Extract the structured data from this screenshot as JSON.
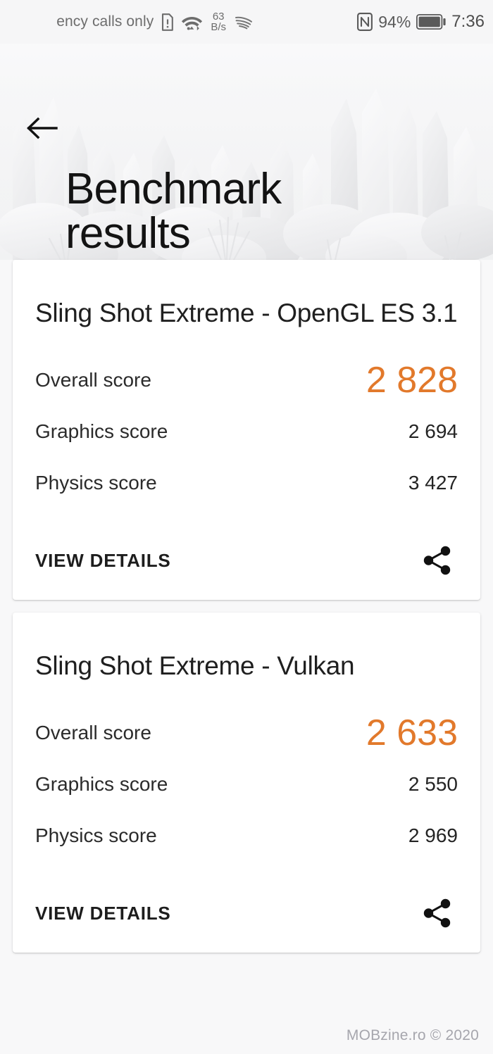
{
  "status_bar": {
    "carrier": "ency calls only",
    "sim_icon": "sim-alert-icon",
    "wifi_icon": "wifi-icon",
    "network_speed_value": "63",
    "network_speed_unit": "B/s",
    "huawei_swirl_icon": "huawei-signal-swirl-icon",
    "nfc_icon": "nfc-icon",
    "battery_percent": "94%",
    "battery_icon": "battery-full-icon",
    "time": "7:36"
  },
  "header": {
    "back_icon": "back-arrow-icon",
    "title": "Benchmark results"
  },
  "colors": {
    "accent_orange": "#e2792b",
    "page_bg": "#f7f7f8",
    "card_bg": "#ffffff",
    "text_primary": "#1f1f1f",
    "watermark": "#a6a6ad"
  },
  "labels": {
    "overall_score": "Overall score",
    "graphics_score": "Graphics score",
    "physics_score": "Physics score",
    "view_details": "VIEW DETAILS",
    "share_icon": "share-icon"
  },
  "cards": [
    {
      "title": "Sling Shot Extreme - OpenGL ES 3.1",
      "overall_score": "2 828",
      "graphics_score": "2 694",
      "physics_score": "3 427"
    },
    {
      "title": "Sling Shot Extreme - Vulkan",
      "overall_score": "2 633",
      "graphics_score": "2 550",
      "physics_score": "2 969"
    }
  ],
  "watermark": "MOBzine.ro © 2020"
}
